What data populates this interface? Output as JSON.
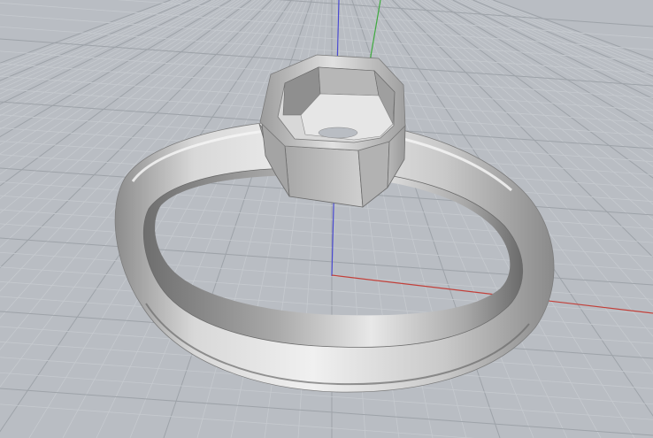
{
  "viewport": {
    "type": "3d-perspective-viewport",
    "model": "ring-with-octagonal-bezel-setting",
    "grid": true,
    "colors": {
      "background": "#b9bdc3",
      "grid_minor": "#c6cacf",
      "grid_major": "#9ea3a9",
      "axis_x": "#c2403a",
      "axis_y": "#3faa3f",
      "axis_z": "#4a4ad0",
      "metal_light": "#e6e6e6",
      "metal_mid": "#bdbdbd",
      "metal_dark": "#7c7c7c",
      "metal_shadow": "#5a5a5a"
    },
    "icons": [
      "world-x-axis",
      "world-y-axis",
      "world-z-axis"
    ]
  }
}
